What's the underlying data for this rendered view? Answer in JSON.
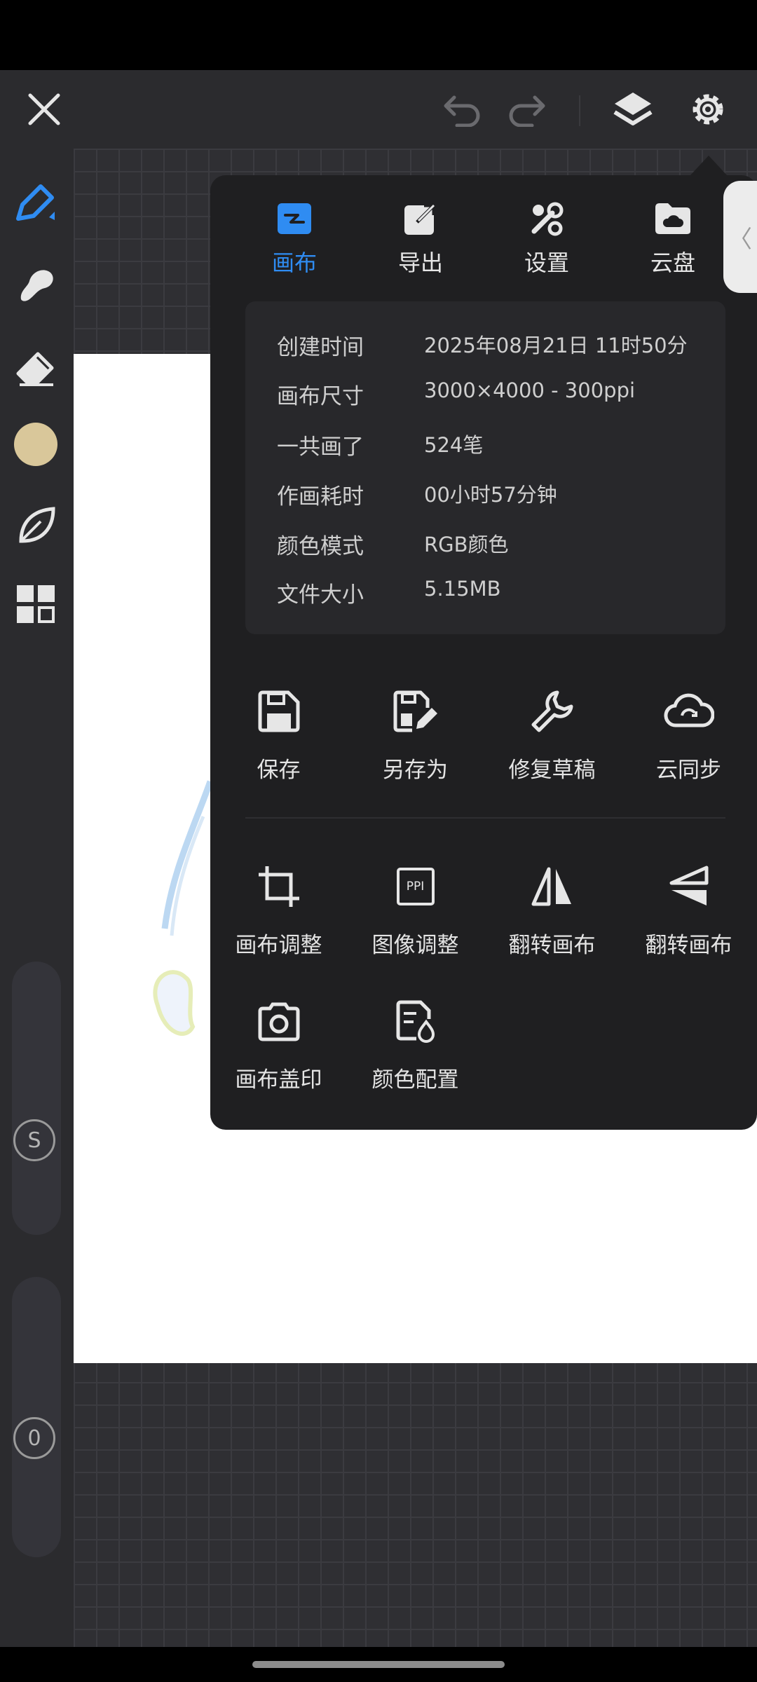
{
  "colors": {
    "accent": "#2f8cf2",
    "panel_bg": "#1f1f21",
    "toolbar_bg": "#2b2b2e",
    "brush_color": "#d9c79a"
  },
  "toolbar": {
    "close_icon": "close-icon",
    "undo_icon": "undo-icon",
    "redo_icon": "redo-icon",
    "layers_icon": "layers-icon",
    "settings_icon": "gear-icon"
  },
  "left_rail": {
    "tools": [
      "pen-tool",
      "smudge-tool",
      "eraser-tool",
      "color-swatch",
      "leaf-tool",
      "grid-tool"
    ],
    "size_badge": "S",
    "opacity_badge": "0"
  },
  "panel": {
    "tabs": [
      {
        "label": "画布",
        "icon": "canvas-icon"
      },
      {
        "label": "导出",
        "icon": "export-icon"
      },
      {
        "label": "设置",
        "icon": "tools-icon"
      },
      {
        "label": "云盘",
        "icon": "cloud-folder-icon"
      }
    ],
    "info": [
      {
        "label": "创建时间",
        "value": "2025年08月21日 11时50分"
      },
      {
        "label": "画布尺寸",
        "value": "3000×4000 - 300ppi"
      },
      {
        "label": "一共画了",
        "value": "524笔"
      },
      {
        "label": "作画耗时",
        "value": "00小时57分钟"
      },
      {
        "label": "颜色模式",
        "value": "RGB颜色"
      },
      {
        "label": "文件大小",
        "value": "5.15MB"
      }
    ],
    "actions_row1": [
      {
        "label": "保存",
        "icon": "save-icon"
      },
      {
        "label": "另存为",
        "icon": "save-as-icon"
      },
      {
        "label": "修复草稿",
        "icon": "wrench-icon"
      },
      {
        "label": "云同步",
        "icon": "cloud-sync-icon"
      }
    ],
    "actions_row2": [
      {
        "label": "画布调整",
        "icon": "crop-icon"
      },
      {
        "label": "图像调整",
        "icon": "ppi-icon"
      },
      {
        "label": "翻转画布",
        "icon": "flip-horizontal-icon"
      },
      {
        "label": "翻转画布",
        "icon": "flip-vertical-icon"
      }
    ],
    "actions_row3": [
      {
        "label": "画布盖印",
        "icon": "camera-icon"
      },
      {
        "label": "颜色配置",
        "icon": "color-profile-icon"
      }
    ],
    "ppi_text": "PPI"
  }
}
